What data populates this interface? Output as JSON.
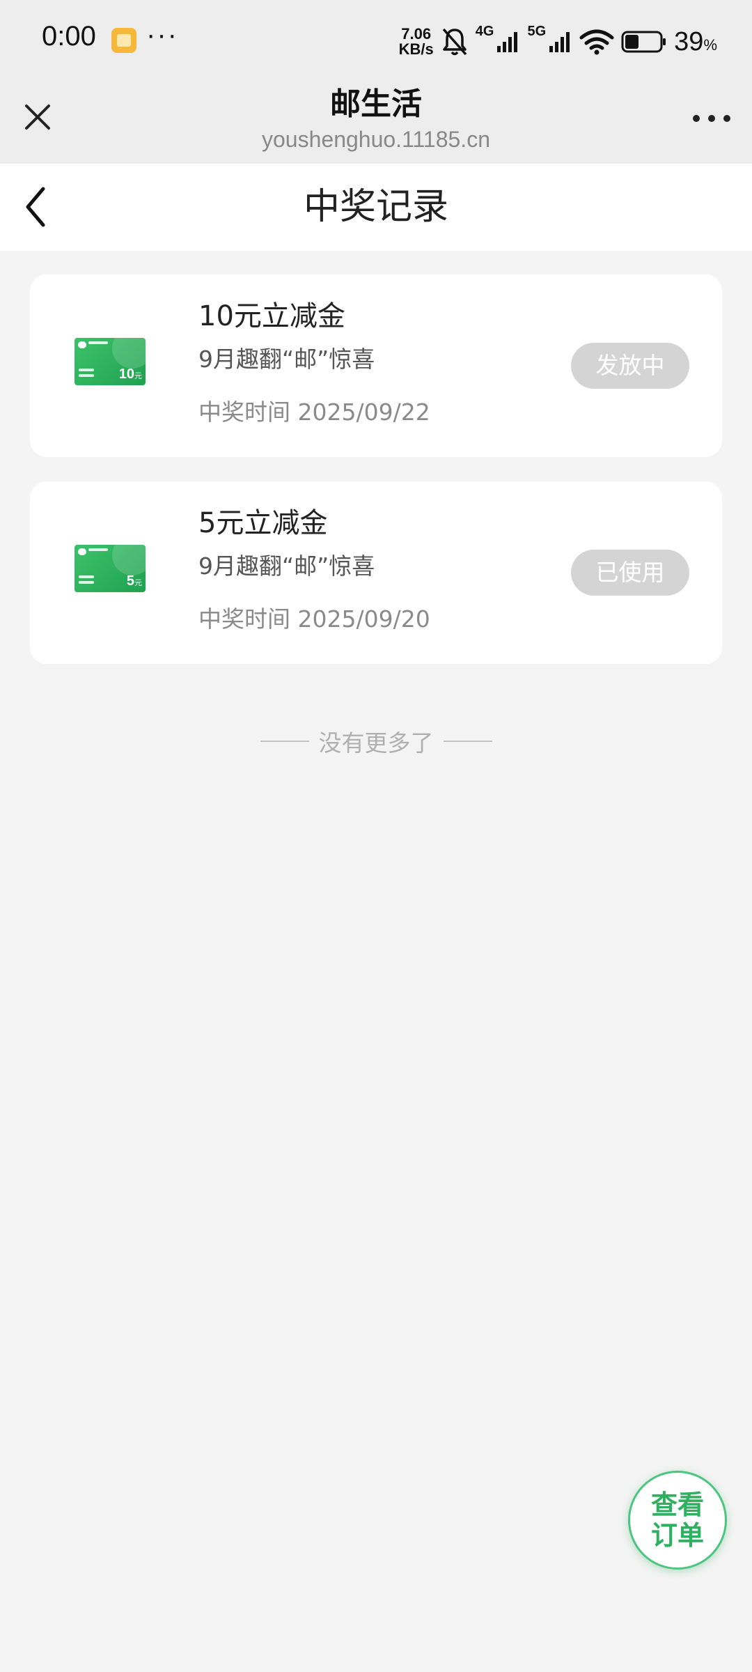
{
  "status_bar": {
    "time": "0:00",
    "more": "···",
    "speed_value": "7.06",
    "speed_unit": "KB/s",
    "net_4g": "4G",
    "net_5g": "5G",
    "battery_value": "39",
    "battery_unit": "%",
    "battery_level": 0.39
  },
  "browser": {
    "title": "邮生活",
    "url": "youshenghuo.11185.cn"
  },
  "page": {
    "title": "中奖记录"
  },
  "records": [
    {
      "title": "10元立减金",
      "subtitle": "9月趣翻“邮”惊喜",
      "time": "中奖时间 2025/09/22",
      "status": "发放中",
      "amount": "10",
      "unit": "元"
    },
    {
      "title": "5元立减金",
      "subtitle": "9月趣翻“邮”惊喜",
      "time": "中奖时间 2025/09/20",
      "status": "已使用",
      "amount": "5",
      "unit": "元"
    }
  ],
  "list_end": "没有更多了",
  "fab": {
    "line1": "查看",
    "line2": "订单"
  },
  "colors": {
    "accent_green": "#2fb060",
    "badge_gray": "#d4d4d4",
    "page_bg": "#f4f4f4"
  },
  "icons": {
    "close": "close-icon",
    "more": "more-icon",
    "back": "back-arrow-icon",
    "coupon": "wechat-pay-coupon-icon"
  }
}
